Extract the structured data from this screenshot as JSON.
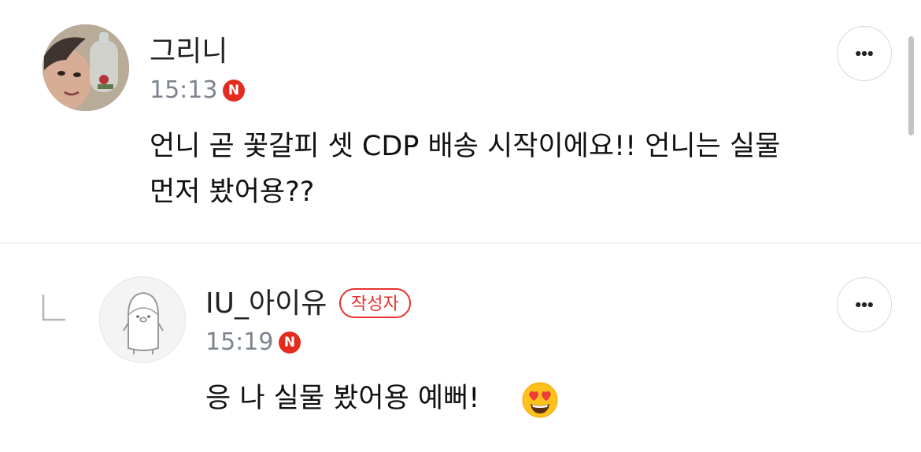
{
  "comments": [
    {
      "author": "그리니",
      "time": "15:13",
      "badge_letter": "N",
      "avatar_icon": "user-photo-avatar",
      "text_line1": "언니 곧 꽃갈피 셋 CDP 배송 시작이에요!! 언니는 실물",
      "text_line2": "먼저 봤어용??"
    },
    {
      "author": "IU_아이유",
      "writer_badge": "작성자",
      "time": "15:19",
      "badge_letter": "N",
      "avatar_icon": "penguin-mascot-avatar",
      "is_reply": true,
      "text": "응 나 실물 봤어용 예뻐!",
      "emoji": "heart-eyes-emoji"
    }
  ],
  "colors": {
    "new_badge": "#e32b1f",
    "writer_badge": "#e5322d",
    "meta_text": "#7d8490",
    "divider": "#e4e4e4"
  },
  "icons": {
    "more": "more-options-icon",
    "reply": "reply-arrow-icon"
  }
}
